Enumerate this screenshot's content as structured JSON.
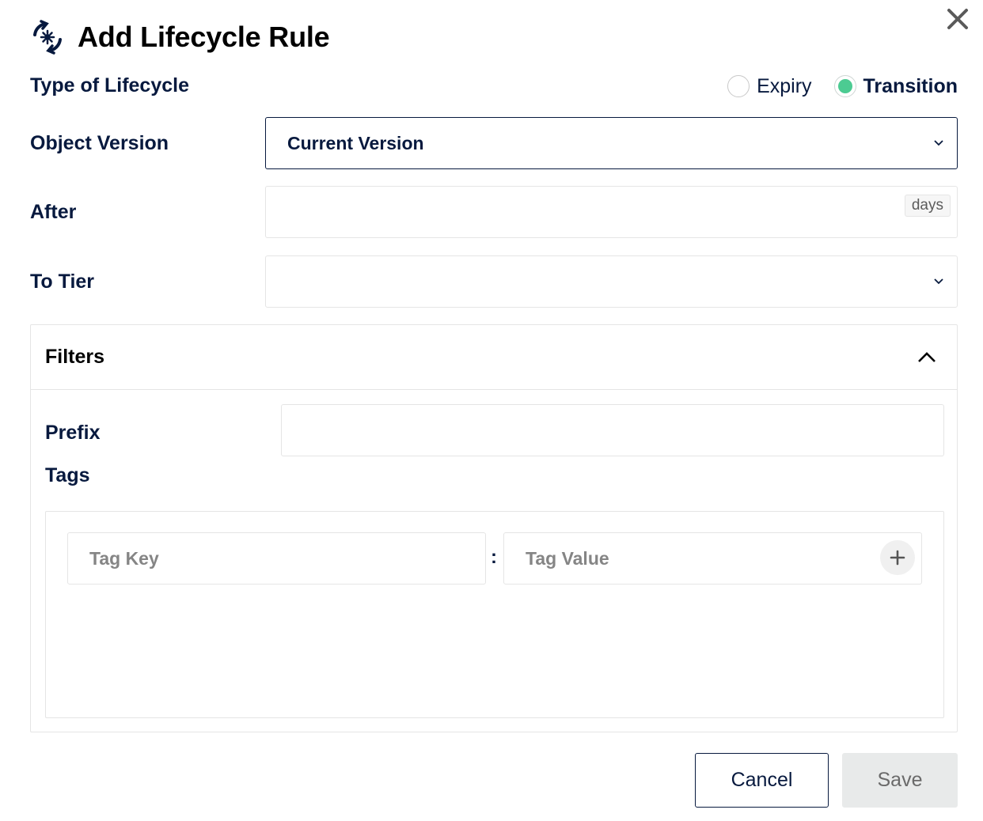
{
  "dialog": {
    "title": "Add Lifecycle Rule",
    "title_icon": "lifecycle-cycle-gear-icon",
    "close_icon": "close-icon"
  },
  "lifecycle_type": {
    "label": "Type of Lifecycle",
    "options": [
      {
        "label": "Expiry",
        "checked": false
      },
      {
        "label": "Transition",
        "checked": true
      }
    ],
    "accent_color": "#4ccb92"
  },
  "object_version": {
    "label": "Object Version",
    "value": "Current Version"
  },
  "after": {
    "label": "After",
    "value": "",
    "unit": "days"
  },
  "to_tier": {
    "label": "To Tier",
    "value": ""
  },
  "filters": {
    "title": "Filters",
    "expanded": true,
    "prefix_label": "Prefix",
    "prefix_value": "",
    "tags_label": "Tags",
    "tag_key_placeholder": "Tag Key",
    "separator": ":",
    "tag_value_placeholder": "Tag Value"
  },
  "actions": {
    "cancel_label": "Cancel",
    "save_label": "Save"
  },
  "colors": {
    "text": "#07193e",
    "border": "#e5e5e5",
    "save_bg": "#e8eaea"
  }
}
